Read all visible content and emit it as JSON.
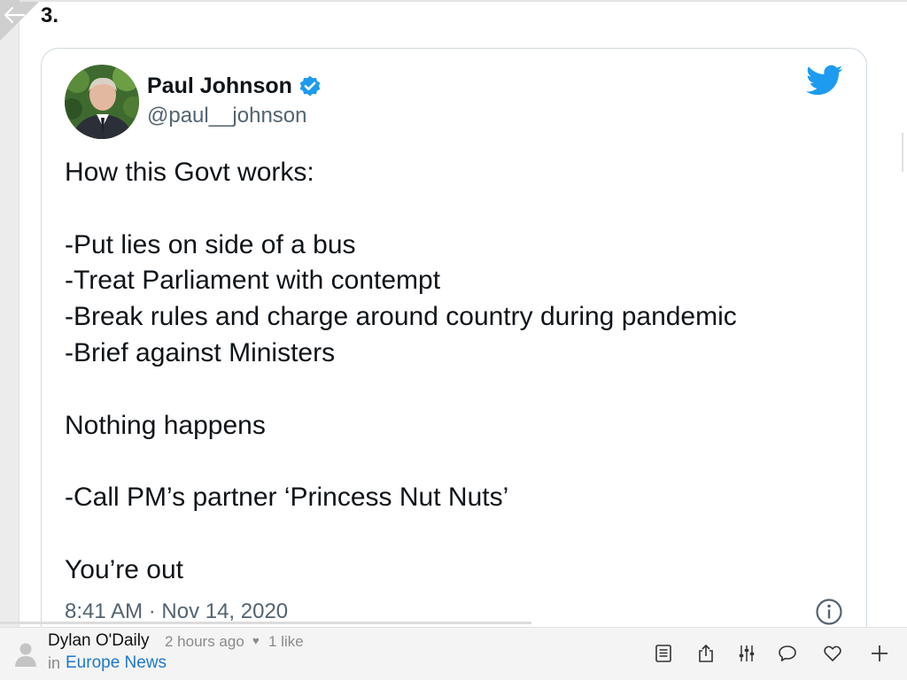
{
  "section": {
    "number": "3."
  },
  "tweet": {
    "author_name": "Paul Johnson",
    "author_handle": "@paul__johnson",
    "lines": [
      "How this Govt works:",
      "",
      "-Put lies on side of a bus",
      "-Treat Parliament with contempt",
      "-Break rules and charge around country during pandemic",
      "-Brief against Ministers",
      "",
      "Nothing happens",
      "",
      "-Call PM’s partner ‘Princess Nut Nuts’",
      "",
      "You’re out"
    ],
    "timestamp": "8:41 AM · Nov 14, 2020"
  },
  "footer": {
    "author": "Dylan O'Daily",
    "time_ago": "2 hours ago",
    "likes": "1 like",
    "in_label": "in",
    "source": "Europe News"
  },
  "icons": {
    "back": "back-arrow-icon",
    "verified": "verified-badge-icon",
    "twitter": "twitter-bird-icon",
    "info": "info-icon",
    "toolbar": [
      "reader-view-icon",
      "share-icon",
      "filter-sliders-icon",
      "comment-icon",
      "heart-icon",
      "plus-icon"
    ]
  },
  "colors": {
    "verified": "#1d9bf0",
    "twitter": "#1d9bf0",
    "link": "#1d78c9",
    "muted": "#536471"
  }
}
